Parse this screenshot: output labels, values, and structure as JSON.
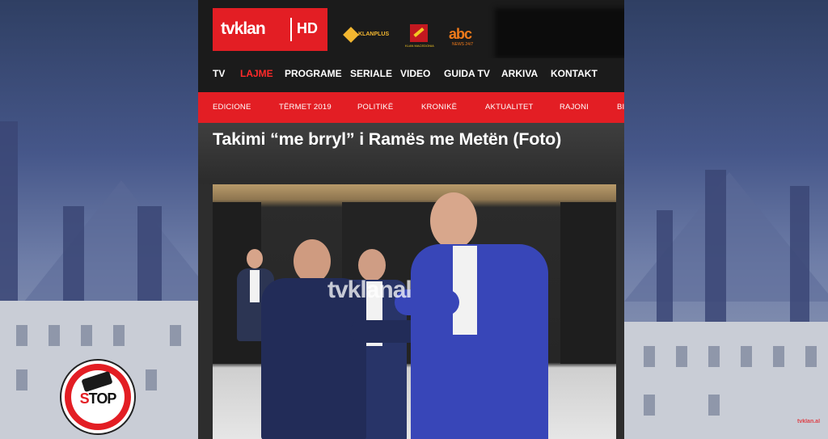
{
  "header": {
    "logo_word": "tvklan",
    "logo_hd": "HD",
    "partners": {
      "klanplus": "KLANPLUS",
      "macedonia": "KLAN MACEDONIA",
      "abc_logo": "abc",
      "abc_sub": "NEWS 24/7"
    }
  },
  "main_nav": [
    "TV",
    "LAJME",
    "PROGRAME",
    "SERIALE",
    "VIDEO",
    "GUIDA TV",
    "ARKIVA",
    "KONTAKT"
  ],
  "main_nav_active": "LAJME",
  "sub_nav": [
    "EDICIONE",
    "TËRMET 2019",
    "POLITIKË",
    "KRONIKË",
    "AKTUALITET",
    "RAJONI",
    "BI"
  ],
  "article": {
    "title": "Takimi “me brryl” i Ramës me Metën (Foto)",
    "photo_watermark": "tvklanal"
  },
  "badge": {
    "stop_s": "S",
    "stop_rest": "TOP"
  },
  "corner_tag": "tvklan.al",
  "colors": {
    "brand_red": "#e31e24",
    "nav_bg": "#1b1b1b",
    "active_nav": "#ff2a2a"
  }
}
